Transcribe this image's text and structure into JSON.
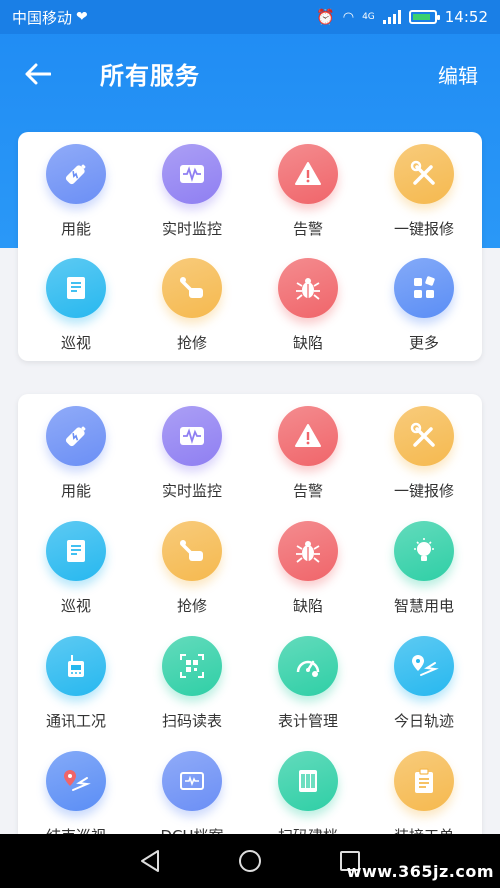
{
  "status_bar": {
    "carrier": "中国移动",
    "network": "4G",
    "time": "14:52"
  },
  "header": {
    "title": "所有服务",
    "edit_label": "编辑"
  },
  "favorites": [
    {
      "label": "用能",
      "icon": "battery-icon",
      "color": "#6b8ff5"
    },
    {
      "label": "实时监控",
      "icon": "waveform-monitor-icon",
      "color": "#8f7ff2"
    },
    {
      "label": "告警",
      "icon": "warning-icon",
      "color": "#f0656a"
    },
    {
      "label": "一键报修",
      "icon": "wrench-screwdriver-icon",
      "color": "#f5b94f"
    },
    {
      "label": "巡视",
      "icon": "document-icon",
      "color": "#27b8ef"
    },
    {
      "label": "抢修",
      "icon": "repair-hand-icon",
      "color": "#f5b94f"
    },
    {
      "label": "缺陷",
      "icon": "bug-icon",
      "color": "#f0656a"
    },
    {
      "label": "更多",
      "icon": "grid-more-icon",
      "color": "#5b8ef5"
    }
  ],
  "services": [
    {
      "label": "用能",
      "icon": "battery-icon",
      "color": "#6b8ff5"
    },
    {
      "label": "实时监控",
      "icon": "waveform-monitor-icon",
      "color": "#8f7ff2"
    },
    {
      "label": "告警",
      "icon": "warning-icon",
      "color": "#f0656a"
    },
    {
      "label": "一键报修",
      "icon": "wrench-screwdriver-icon",
      "color": "#f5b94f"
    },
    {
      "label": "巡视",
      "icon": "document-icon",
      "color": "#27b8ef"
    },
    {
      "label": "抢修",
      "icon": "repair-hand-icon",
      "color": "#f5b94f"
    },
    {
      "label": "缺陷",
      "icon": "bug-icon",
      "color": "#f0656a"
    },
    {
      "label": "智慧用电",
      "icon": "smart-bulb-icon",
      "color": "#2fcfa6"
    },
    {
      "label": "通讯工况",
      "icon": "router-icon",
      "color": "#27b8ef"
    },
    {
      "label": "扫码读表",
      "icon": "qr-scan-icon",
      "color": "#2fcfa6"
    },
    {
      "label": "表计管理",
      "icon": "gauge-icon",
      "color": "#2fcfa6"
    },
    {
      "label": "今日轨迹",
      "icon": "location-track-icon",
      "color": "#27b8ef"
    },
    {
      "label": "结束巡视",
      "icon": "location-end-icon",
      "color": "#5b8ef5"
    },
    {
      "label": "DCU档案",
      "icon": "dcu-device-icon",
      "color": "#6b8ff5"
    },
    {
      "label": "扫码建档",
      "icon": "barcode-icon",
      "color": "#2fcfa6"
    },
    {
      "label": "装接工单",
      "icon": "clipboard-icon",
      "color": "#f5b94f"
    }
  ],
  "watermark": "www.365jz.com"
}
